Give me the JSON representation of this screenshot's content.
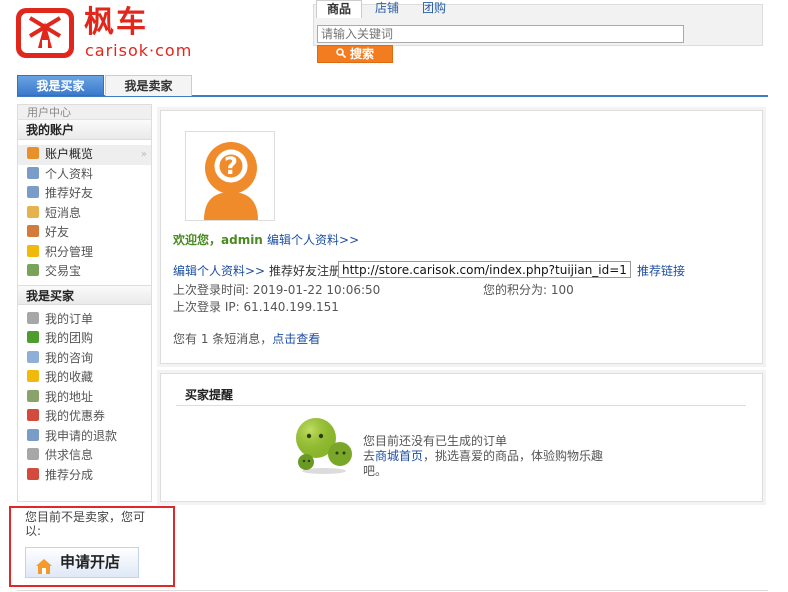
{
  "brand": {
    "cn": "枫车",
    "en": "carisok·com"
  },
  "search": {
    "tabs": [
      "商品",
      "店铺",
      "团购"
    ],
    "placeholder": "请输入关键词",
    "button_label": "搜索"
  },
  "role_tabs": {
    "buyer": "我是买家",
    "seller": "我是卖家"
  },
  "sidebar": {
    "user_center": "用户中心",
    "account_title": "我的账户",
    "account_items": [
      {
        "label": "账户概览",
        "icon": "home-icon",
        "color": "#e8912a"
      },
      {
        "label": "个人资料",
        "icon": "profile-card-icon",
        "color": "#7a9cc8"
      },
      {
        "label": "推荐好友",
        "icon": "recommend-friend-icon",
        "color": "#7a9cc8"
      },
      {
        "label": "短消息",
        "icon": "envelope-icon",
        "color": "#e5b24d"
      },
      {
        "label": "好友",
        "icon": "friend-icon",
        "color": "#d27b3a"
      },
      {
        "label": "积分管理",
        "icon": "star-icon",
        "color": "#f0b90b"
      },
      {
        "label": "交易宝",
        "icon": "trade-icon",
        "color": "#7aa35a"
      }
    ],
    "buyer_title": "我是买家",
    "buyer_items": [
      {
        "label": "我的订单",
        "icon": "order-icon",
        "color": "#a7a7a7"
      },
      {
        "label": "我的团购",
        "icon": "group-buy-icon",
        "color": "#4f9c2e"
      },
      {
        "label": "我的咨询",
        "icon": "consult-icon",
        "color": "#8eb0d8"
      },
      {
        "label": "我的收藏",
        "icon": "favorite-star-icon",
        "color": "#f0b90b"
      },
      {
        "label": "我的地址",
        "icon": "address-icon",
        "color": "#8aa36b"
      },
      {
        "label": "我的优惠券",
        "icon": "coupon-icon",
        "color": "#d44a3c"
      },
      {
        "label": "我申请的退款",
        "icon": "refund-icon",
        "color": "#7a9cc8"
      },
      {
        "label": "供求信息",
        "icon": "supply-icon",
        "color": "#a7a7a7"
      },
      {
        "label": "推荐分成",
        "icon": "commission-icon",
        "color": "#d44a3c"
      }
    ],
    "not_seller": "您目前不是卖家，您可以:",
    "open_shop": "申请开店"
  },
  "profile": {
    "welcome_prefix": "欢迎您，admin",
    "edit_profile": "编辑个人资料>>",
    "edit_profile2": "编辑个人资料>>",
    "referral_label": "推荐好友注册:",
    "referral_url": "http://store.carisok.com/index.php?tuijian_id=1",
    "referral_link": "推荐链接",
    "last_login_time": "上次登录时间: 2019-01-22 10:06:50",
    "points": "您的积分为: 100",
    "last_login_ip": "上次登录 IP: 61.140.199.151",
    "messages_prefix": "您有 1 条短消息，",
    "messages_link": "点击查看"
  },
  "reminder": {
    "title": "买家提醒",
    "no_orders": "您目前还没有已生成的订单",
    "go_prefix": "去",
    "shop_home": "商城首页",
    "go_suffix": "，挑选喜爱的商品，体验购物乐趣吧。"
  },
  "colors": {
    "brand_red": "#e1261c",
    "accent_orange": "#f47c20",
    "tab_blue": "#3b7acb",
    "link_blue": "#1d4fa2",
    "welcome_green": "#4a8b21",
    "highlight_red": "#e02828"
  }
}
